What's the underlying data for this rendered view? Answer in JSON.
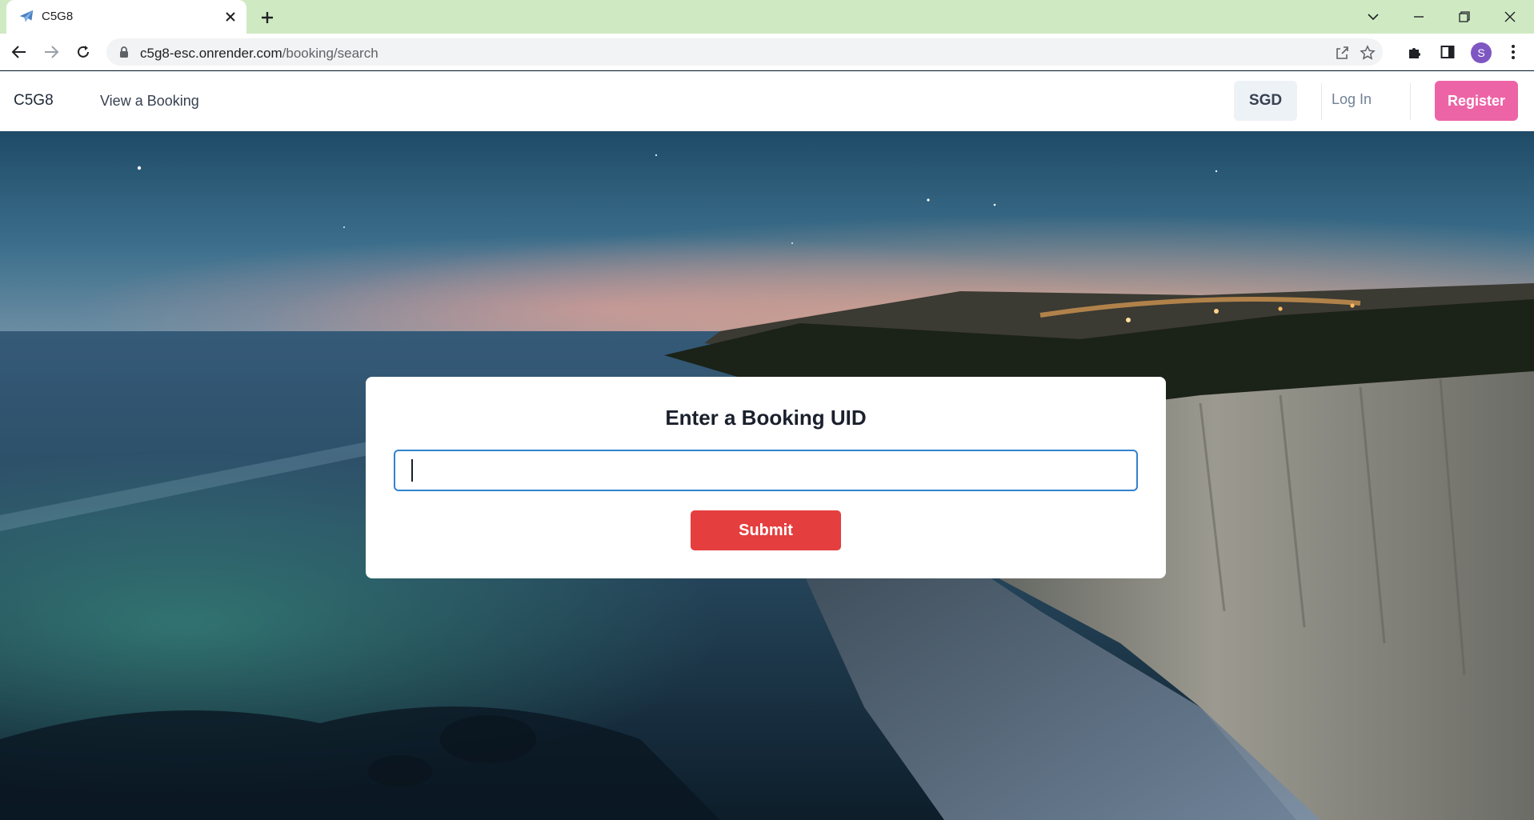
{
  "browser": {
    "tab_title": "C5G8",
    "url_host": "c5g8-esc.onrender.com",
    "url_path": "/booking/search",
    "profile_initial": "S"
  },
  "site": {
    "brand": "C5G8",
    "nav_view_booking": "View a Booking",
    "currency": "SGD",
    "login": "Log In",
    "register": "Register"
  },
  "search_card": {
    "title": "Enter a Booking UID",
    "input_value": "",
    "input_placeholder": "",
    "submit_label": "Submit"
  },
  "colors": {
    "accent_blue": "#3182ce",
    "submit_red": "#e53e3e",
    "register_pink": "#ed64a6",
    "tabstrip_green": "#cfeac3"
  },
  "icons": {
    "favicon": "airplane-icon",
    "back": "back-arrow-icon",
    "forward": "forward-arrow-icon",
    "reload": "reload-icon",
    "lock": "lock-icon",
    "share": "share-icon",
    "bookmark": "star-icon",
    "extensions": "puzzle-icon",
    "sidepanel": "side-panel-icon",
    "menu": "kebab-menu-icon"
  }
}
